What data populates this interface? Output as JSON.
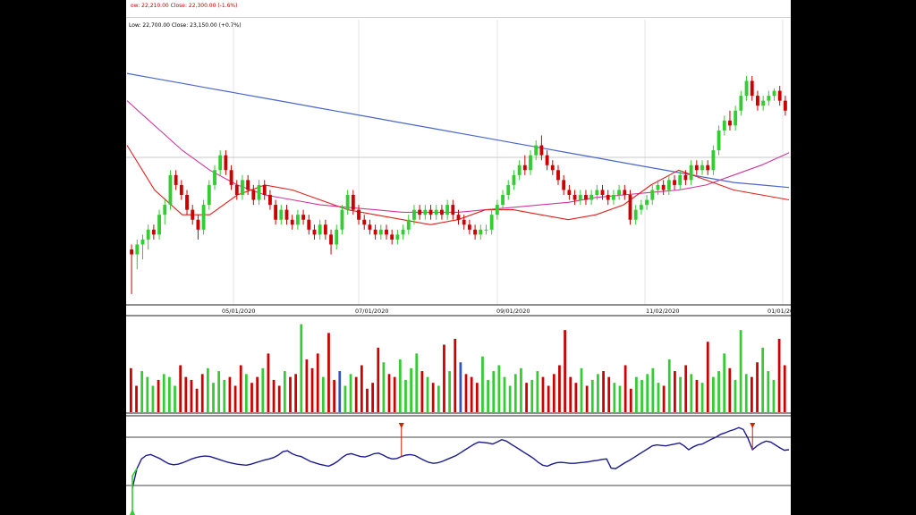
{
  "header": {
    "line1": "ow: 22,210.00  Close: 22,300.00 (-1.6%)",
    "line2": "Low: 22,700.00  Close: 23,150.00 (+0.7%)"
  },
  "colors": {
    "up": "#33cc33",
    "down": "#cc0000",
    "ma_long": "#4a67cc",
    "ma_mid": "#d0359e",
    "ma_short": "#e0201c",
    "oscillator": "#1c1c90",
    "marker": "#cc2200",
    "volume_other": "#3355bb"
  },
  "chart_data": [
    {
      "type": "candlestick",
      "x_ticks": [
        "05/01/2020",
        "07/01/2020",
        "09/01/2020",
        "11/02/2020",
        "01/01/202"
      ],
      "candles": [
        {
          "o": 81,
          "h": 82,
          "l": 72,
          "c": 80
        },
        {
          "o": 80,
          "h": 83,
          "l": 77,
          "c": 82
        },
        {
          "o": 82,
          "h": 84,
          "l": 79,
          "c": 83
        },
        {
          "o": 83,
          "h": 86,
          "l": 81,
          "c": 85
        },
        {
          "o": 85,
          "h": 86,
          "l": 83,
          "c": 84
        },
        {
          "o": 84,
          "h": 89,
          "l": 83,
          "c": 88
        },
        {
          "o": 88,
          "h": 91,
          "l": 86,
          "c": 90
        },
        {
          "o": 90,
          "h": 97,
          "l": 89,
          "c": 96
        },
        {
          "o": 96,
          "h": 97,
          "l": 93,
          "c": 94
        },
        {
          "o": 94,
          "h": 95,
          "l": 91,
          "c": 92
        },
        {
          "o": 92,
          "h": 93,
          "l": 88,
          "c": 89
        },
        {
          "o": 89,
          "h": 90,
          "l": 86,
          "c": 87
        },
        {
          "o": 87,
          "h": 88,
          "l": 83,
          "c": 85
        },
        {
          "o": 85,
          "h": 91,
          "l": 84,
          "c": 90
        },
        {
          "o": 90,
          "h": 95,
          "l": 89,
          "c": 94
        },
        {
          "o": 94,
          "h": 98,
          "l": 93,
          "c": 97
        },
        {
          "o": 97,
          "h": 101,
          "l": 96,
          "c": 100
        },
        {
          "o": 100,
          "h": 101,
          "l": 96,
          "c": 97
        },
        {
          "o": 97,
          "h": 98,
          "l": 93,
          "c": 94
        },
        {
          "o": 94,
          "h": 95,
          "l": 91,
          "c": 92
        },
        {
          "o": 92,
          "h": 96,
          "l": 91,
          "c": 95
        },
        {
          "o": 95,
          "h": 96,
          "l": 92,
          "c": 93
        },
        {
          "o": 93,
          "h": 94,
          "l": 90,
          "c": 91
        },
        {
          "o": 91,
          "h": 95,
          "l": 90,
          "c": 94
        },
        {
          "o": 94,
          "h": 95,
          "l": 91,
          "c": 92
        },
        {
          "o": 92,
          "h": 93,
          "l": 89,
          "c": 90
        },
        {
          "o": 90,
          "h": 91,
          "l": 86,
          "c": 87
        },
        {
          "o": 87,
          "h": 90,
          "l": 86,
          "c": 89
        },
        {
          "o": 89,
          "h": 90,
          "l": 86,
          "c": 87
        },
        {
          "o": 87,
          "h": 88,
          "l": 85,
          "c": 86
        },
        {
          "o": 86,
          "h": 89,
          "l": 85,
          "c": 88
        },
        {
          "o": 88,
          "h": 89,
          "l": 86,
          "c": 87
        },
        {
          "o": 87,
          "h": 88,
          "l": 84,
          "c": 85
        },
        {
          "o": 85,
          "h": 86,
          "l": 83,
          "c": 84
        },
        {
          "o": 84,
          "h": 87,
          "l": 83,
          "c": 86
        },
        {
          "o": 86,
          "h": 87,
          "l": 83,
          "c": 84
        },
        {
          "o": 84,
          "h": 85,
          "l": 80,
          "c": 82
        },
        {
          "o": 82,
          "h": 86,
          "l": 81,
          "c": 85
        },
        {
          "o": 85,
          "h": 90,
          "l": 84,
          "c": 89
        },
        {
          "o": 89,
          "h": 93,
          "l": 88,
          "c": 92
        },
        {
          "o": 92,
          "h": 93,
          "l": 88,
          "c": 89
        },
        {
          "o": 89,
          "h": 90,
          "l": 86,
          "c": 87
        },
        {
          "o": 87,
          "h": 88,
          "l": 85,
          "c": 86
        },
        {
          "o": 86,
          "h": 87,
          "l": 84,
          "c": 85
        },
        {
          "o": 85,
          "h": 86,
          "l": 83,
          "c": 84
        },
        {
          "o": 84,
          "h": 86,
          "l": 83,
          "c": 85
        },
        {
          "o": 85,
          "h": 86,
          "l": 83,
          "c": 84
        },
        {
          "o": 84,
          "h": 85,
          "l": 82,
          "c": 83
        },
        {
          "o": 83,
          "h": 85,
          "l": 82,
          "c": 84
        },
        {
          "o": 84,
          "h": 86,
          "l": 83,
          "c": 85
        },
        {
          "o": 85,
          "h": 88,
          "l": 84,
          "c": 87
        },
        {
          "o": 87,
          "h": 90,
          "l": 86,
          "c": 89
        },
        {
          "o": 89,
          "h": 90,
          "l": 87,
          "c": 88
        },
        {
          "o": 88,
          "h": 90,
          "l": 87,
          "c": 89
        },
        {
          "o": 89,
          "h": 90,
          "l": 87,
          "c": 88
        },
        {
          "o": 88,
          "h": 90,
          "l": 87,
          "c": 89
        },
        {
          "o": 89,
          "h": 90,
          "l": 87,
          "c": 88
        },
        {
          "o": 88,
          "h": 91,
          "l": 87,
          "c": 90
        },
        {
          "o": 90,
          "h": 91,
          "l": 87,
          "c": 88
        },
        {
          "o": 88,
          "h": 89,
          "l": 86,
          "c": 87
        },
        {
          "o": 87,
          "h": 88,
          "l": 85,
          "c": 86
        },
        {
          "o": 86,
          "h": 87,
          "l": 84,
          "c": 85
        },
        {
          "o": 85,
          "h": 86,
          "l": 83,
          "c": 84
        },
        {
          "o": 84,
          "h": 86,
          "l": 83,
          "c": 85
        },
        {
          "o": 85,
          "h": 86,
          "l": 84,
          "c": 85
        },
        {
          "o": 85,
          "h": 89,
          "l": 84,
          "c": 88
        },
        {
          "o": 88,
          "h": 91,
          "l": 87,
          "c": 90
        },
        {
          "o": 90,
          "h": 93,
          "l": 89,
          "c": 92
        },
        {
          "o": 92,
          "h": 95,
          "l": 91,
          "c": 94
        },
        {
          "o": 94,
          "h": 97,
          "l": 93,
          "c": 96
        },
        {
          "o": 96,
          "h": 99,
          "l": 95,
          "c": 98
        },
        {
          "o": 98,
          "h": 100,
          "l": 96,
          "c": 97
        },
        {
          "o": 97,
          "h": 101,
          "l": 96,
          "c": 100
        },
        {
          "o": 100,
          "h": 103,
          "l": 99,
          "c": 102
        },
        {
          "o": 102,
          "h": 104,
          "l": 99,
          "c": 100
        },
        {
          "o": 100,
          "h": 101,
          "l": 97,
          "c": 98
        },
        {
          "o": 98,
          "h": 99,
          "l": 96,
          "c": 97
        },
        {
          "o": 97,
          "h": 98,
          "l": 94,
          "c": 95
        },
        {
          "o": 95,
          "h": 96,
          "l": 92,
          "c": 93
        },
        {
          "o": 93,
          "h": 94,
          "l": 91,
          "c": 92
        },
        {
          "o": 92,
          "h": 93,
          "l": 90,
          "c": 91
        },
        {
          "o": 91,
          "h": 93,
          "l": 90,
          "c": 92
        },
        {
          "o": 92,
          "h": 93,
          "l": 90,
          "c": 91
        },
        {
          "o": 91,
          "h": 93,
          "l": 90,
          "c": 92
        },
        {
          "o": 92,
          "h": 94,
          "l": 91,
          "c": 93
        },
        {
          "o": 93,
          "h": 94,
          "l": 91,
          "c": 92
        },
        {
          "o": 92,
          "h": 93,
          "l": 90,
          "c": 91
        },
        {
          "o": 91,
          "h": 93,
          "l": 90,
          "c": 92
        },
        {
          "o": 92,
          "h": 94,
          "l": 91,
          "c": 93
        },
        {
          "o": 93,
          "h": 94,
          "l": 91,
          "c": 92
        },
        {
          "o": 92,
          "h": 93,
          "l": 86,
          "c": 87
        },
        {
          "o": 87,
          "h": 90,
          "l": 86,
          "c": 89
        },
        {
          "o": 89,
          "h": 91,
          "l": 88,
          "c": 90
        },
        {
          "o": 90,
          "h": 92,
          "l": 89,
          "c": 91
        },
        {
          "o": 91,
          "h": 94,
          "l": 90,
          "c": 93
        },
        {
          "o": 93,
          "h": 95,
          "l": 92,
          "c": 94
        },
        {
          "o": 94,
          "h": 95,
          "l": 92,
          "c": 93
        },
        {
          "o": 93,
          "h": 96,
          "l": 92,
          "c": 95
        },
        {
          "o": 95,
          "h": 96,
          "l": 93,
          "c": 94
        },
        {
          "o": 94,
          "h": 97,
          "l": 93,
          "c": 96
        },
        {
          "o": 96,
          "h": 97,
          "l": 94,
          "c": 95
        },
        {
          "o": 95,
          "h": 99,
          "l": 94,
          "c": 98
        },
        {
          "o": 98,
          "h": 99,
          "l": 96,
          "c": 97
        },
        {
          "o": 97,
          "h": 99,
          "l": 96,
          "c": 98
        },
        {
          "o": 98,
          "h": 99,
          "l": 96,
          "c": 97
        },
        {
          "o": 97,
          "h": 102,
          "l": 96,
          "c": 101
        },
        {
          "o": 101,
          "h": 106,
          "l": 100,
          "c": 105
        },
        {
          "o": 105,
          "h": 108,
          "l": 104,
          "c": 107
        },
        {
          "o": 107,
          "h": 109,
          "l": 105,
          "c": 106
        },
        {
          "o": 106,
          "h": 110,
          "l": 105,
          "c": 109
        },
        {
          "o": 109,
          "h": 113,
          "l": 108,
          "c": 112
        },
        {
          "o": 112,
          "h": 116,
          "l": 111,
          "c": 115
        },
        {
          "o": 115,
          "h": 116,
          "l": 111,
          "c": 112
        },
        {
          "o": 112,
          "h": 113,
          "l": 109,
          "c": 110
        },
        {
          "o": 110,
          "h": 112,
          "l": 109,
          "c": 111
        },
        {
          "o": 111,
          "h": 113,
          "l": 110,
          "c": 112
        },
        {
          "o": 112,
          "h": 113.5,
          "l": 111,
          "c": 113
        },
        {
          "o": 113,
          "h": 114,
          "l": 110,
          "c": 111
        },
        {
          "o": 111,
          "h": 112,
          "l": 108,
          "c": 109
        }
      ],
      "ma_long": [
        116.5,
        115.5,
        114.5,
        113.5,
        112.5,
        111.5,
        110.5,
        109.5,
        108.5,
        107.5,
        106.5,
        105.5,
        104.5,
        103.5,
        102.5,
        101.5,
        100.5,
        99.5,
        98.5,
        97.5,
        96.5,
        95.5,
        94.5,
        94.0,
        93.5
      ],
      "ma_mid": [
        111,
        106,
        101,
        97,
        94,
        92,
        91,
        90,
        89.5,
        89,
        88.5,
        88.5,
        88.5,
        89,
        89.5,
        90,
        90.5,
        91.5,
        92,
        92.5,
        93,
        94,
        96,
        98,
        100.5
      ],
      "ma_short": [
        102,
        93,
        88,
        88,
        92,
        94,
        93,
        91,
        89,
        88,
        87,
        86,
        87,
        89,
        89,
        88,
        87,
        88,
        90,
        94,
        97,
        95,
        93,
        92,
        91
      ]
    },
    {
      "type": "bar",
      "name": "volume",
      "values": [
        15,
        9,
        14,
        12,
        9,
        11,
        13,
        12,
        9,
        16,
        12,
        11,
        8,
        13,
        15,
        10,
        14,
        11,
        12,
        9,
        16,
        13,
        10,
        12,
        15,
        20,
        11,
        9,
        14,
        12,
        13,
        30,
        18,
        15,
        20,
        12,
        27,
        11,
        14,
        9,
        13,
        12,
        16,
        8,
        10,
        22,
        17,
        13,
        12,
        18,
        11,
        15,
        20,
        14,
        12,
        10,
        9,
        23,
        14,
        25,
        17,
        13,
        12,
        10,
        19,
        11,
        14,
        16,
        12,
        9,
        13,
        15,
        10,
        11,
        14,
        12,
        9,
        13,
        16,
        28,
        12,
        10,
        15,
        9,
        11,
        13,
        14,
        12,
        10,
        9,
        16,
        8,
        12,
        11,
        13,
        15,
        10,
        9,
        18,
        14,
        12,
        16,
        13,
        11,
        10,
        24,
        12,
        14,
        20,
        15,
        11,
        28,
        13,
        12,
        17,
        22,
        14,
        11,
        25,
        16
      ]
    },
    {
      "type": "line",
      "name": "oscillator",
      "values": [
        -0.05,
        0.35,
        0.55,
        0.62,
        0.64,
        0.6,
        0.56,
        0.5,
        0.45,
        0.43,
        0.44,
        0.47,
        0.51,
        0.55,
        0.58,
        0.6,
        0.61,
        0.6,
        0.57,
        0.54,
        0.51,
        0.48,
        0.46,
        0.44,
        0.43,
        0.42,
        0.44,
        0.47,
        0.5,
        0.53,
        0.55,
        0.58,
        0.63,
        0.7,
        0.72,
        0.66,
        0.62,
        0.6,
        0.55,
        0.5,
        0.47,
        0.44,
        0.42,
        0.4,
        0.44,
        0.5,
        0.58,
        0.64,
        0.66,
        0.63,
        0.6,
        0.59,
        0.62,
        0.66,
        0.67,
        0.63,
        0.58,
        0.55,
        0.56,
        0.6,
        0.63,
        0.64,
        0.62,
        0.57,
        0.52,
        0.48,
        0.46,
        0.47,
        0.5,
        0.54,
        0.58,
        0.62,
        0.68,
        0.74,
        0.8,
        0.86,
        0.9,
        0.89,
        0.88,
        0.86,
        0.9,
        0.95,
        0.92,
        0.86,
        0.8,
        0.74,
        0.68,
        0.62,
        0.56,
        0.48,
        0.42,
        0.4,
        0.44,
        0.47,
        0.48,
        0.47,
        0.46,
        0.46,
        0.47,
        0.48,
        0.49,
        0.51,
        0.52,
        0.54,
        0.55,
        0.36,
        0.35,
        0.41,
        0.47,
        0.52,
        0.58,
        0.64,
        0.7,
        0.76,
        0.82,
        0.84,
        0.83,
        0.82,
        0.84,
        0.86,
        0.88,
        0.82,
        0.74,
        0.8,
        0.84,
        0.86,
        0.91,
        0.96,
        1.0,
        1.06,
        1.09,
        1.13,
        1.16,
        1.2,
        1.16,
        0.98,
        0.74,
        0.82,
        0.88,
        0.92,
        0.9,
        0.84,
        0.78,
        0.73,
        0.74
      ],
      "markers": [
        59,
        136
      ]
    }
  ]
}
